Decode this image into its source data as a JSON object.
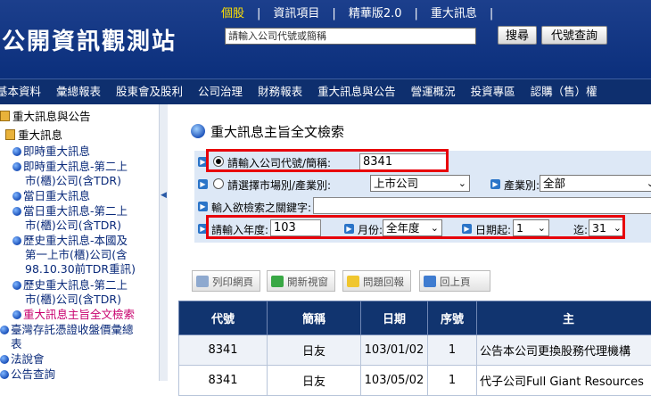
{
  "header": {
    "site_title": "公開資訊觀測站",
    "top_links": [
      {
        "label": "個股",
        "active": true
      },
      {
        "label": "資訊項目",
        "active": false
      },
      {
        "label": "精華版2.0",
        "active": false
      },
      {
        "label": "重大訊息",
        "active": false
      }
    ],
    "search_placeholder": "請輸入公司代號或簡稱",
    "search_button": "搜尋",
    "code_lookup_button": "代號查詢"
  },
  "menu": [
    "基本資料",
    "彙總報表",
    "股東會及股利",
    "公司治理",
    "財務報表",
    "重大訊息與公告",
    "營運概況",
    "投資專區",
    "認購（售）權"
  ],
  "sidebar": {
    "root": "重大訊息與公告",
    "group": "重大訊息",
    "items": [
      "即時重大訊息",
      "即時重大訊息-第二上市(櫃)公司(含TDR)",
      "當日重大訊息",
      "當日重大訊息-第二上市(櫃)公司(含TDR)",
      "歷史重大訊息-本國及第一上市(櫃)公司(含98.10.30前TDR重訊)",
      "歷史重大訊息-第二上市(櫃)公司(含TDR)",
      "重大訊息主旨全文檢索"
    ],
    "items_lines": [
      [
        "即時重大訊息"
      ],
      [
        "即時重大訊息-第二上",
        "市(櫃)公司(含TDR)"
      ],
      [
        "當日重大訊息"
      ],
      [
        "當日重大訊息-第二上",
        "市(櫃)公司(含TDR)"
      ],
      [
        "歷史重大訊息-本國及",
        "第一上市(櫃)公司(含",
        "98.10.30前TDR重訊)"
      ],
      [
        "歷史重大訊息-第二上",
        "市(櫃)公司(含TDR)"
      ],
      [
        "重大訊息主旨全文檢索"
      ]
    ],
    "after": [
      [
        "臺灣存託憑證收盤價彙總",
        "表"
      ],
      [
        "法說會"
      ],
      [
        "公告查詢"
      ]
    ]
  },
  "main": {
    "page_title": "重大訊息主旨全文檢索",
    "form": {
      "company_label": "請輸入公司代號/簡稱:",
      "company_value": "8341",
      "market_label": "請選擇市場別/產業別:",
      "market_value": "上市公司",
      "industry_label": "產業別:",
      "industry_value": "全部",
      "keyword_label": "輸入欲檢索之關鍵字:",
      "keyword_value": "",
      "year_label": "請輸入年度:",
      "year_value": "103",
      "month_label": "月份:",
      "month_value": "全年度",
      "day_from_label": "日期起:",
      "day_from_value": "1",
      "day_to_label": "迄:",
      "day_to_value": "31"
    },
    "actions": [
      "列印網頁",
      "開新視窗",
      "問題回報",
      "回上頁"
    ],
    "table": {
      "columns": [
        "代號",
        "簡稱",
        "日期",
        "序號",
        "主"
      ],
      "rows": [
        [
          "8341",
          "日友",
          "103/01/02",
          "1",
          "公告本公司更換股務代理機構"
        ],
        [
          "8341",
          "日友",
          "103/05/02",
          "1",
          "代子公司Full Giant Resources"
        ]
      ]
    }
  },
  "colors": {
    "header_bg": "#0b2f7c",
    "menu_bg": "#0e2f6e",
    "highlight": "#e8000a",
    "active_link": "#ffe000",
    "table_header": "#11346f"
  }
}
